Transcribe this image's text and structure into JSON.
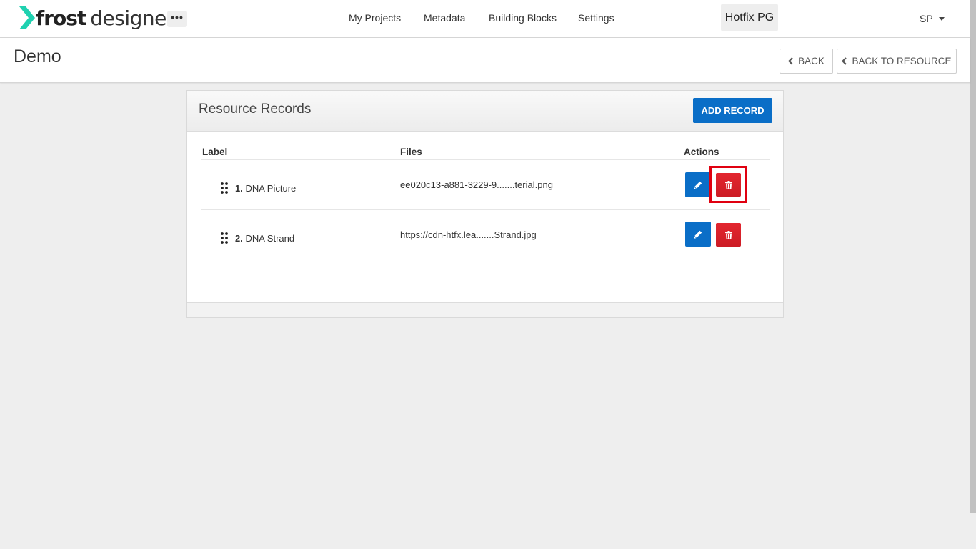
{
  "app": {
    "brand_bold": "frost",
    "brand_light": "designer",
    "more_label": "•••",
    "brand_color": "#1fd1b0"
  },
  "nav": {
    "items": [
      {
        "label": "My Projects"
      },
      {
        "label": "Metadata"
      },
      {
        "label": "Building Blocks"
      },
      {
        "label": "Settings"
      }
    ],
    "project": "Hotfix PG",
    "user": "SP"
  },
  "page": {
    "title": "Demo",
    "back_label": "BACK",
    "back_to_resource_label": "BACK TO RESOURCE"
  },
  "panel": {
    "title": "Resource Records",
    "add_label": "ADD RECORD",
    "columns": [
      "Label",
      "Files",
      "Actions"
    ],
    "rows": [
      {
        "num": "1.",
        "label": "DNA Picture",
        "file": "ee020c13-a881-3229-9.......terial.png"
      },
      {
        "num": "2.",
        "label": "DNA Strand",
        "file": "https://cdn-htfx.lea.......Strand.jpg"
      }
    ]
  },
  "colors": {
    "primary": "#0a6ec7",
    "danger": "#d9202a",
    "highlight": "#e00010"
  }
}
